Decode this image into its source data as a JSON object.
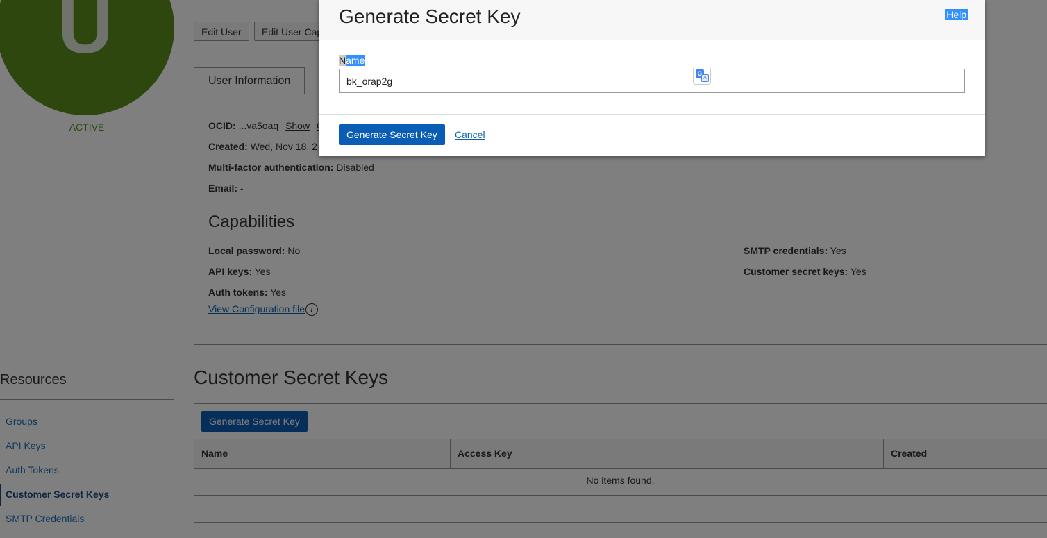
{
  "user": {
    "avatar_letter": "U",
    "status": "ACTIVE"
  },
  "actions": {
    "edit_user": "Edit User",
    "edit_capabilities": "Edit User Cap"
  },
  "tabs": {
    "user_information": "User Information"
  },
  "info": {
    "ocid_label": "OCID:",
    "ocid_value": "...va5oaq",
    "ocid_show": "Show",
    "ocid_copy": "C",
    "created_label": "Created:",
    "created_value": "Wed, Nov 18, 2",
    "mfa_label": "Multi-factor authentication:",
    "mfa_value": "Disabled",
    "email_label": "Email:",
    "email_value": "-"
  },
  "capabilities": {
    "title": "Capabilities",
    "local_password_label": "Local password:",
    "local_password_value": "No",
    "api_keys_label": "API keys:",
    "api_keys_value": "Yes",
    "auth_tokens_label": "Auth tokens:",
    "auth_tokens_value": "Yes",
    "smtp_label": "SMTP credentials:",
    "smtp_value": "Yes",
    "customer_secret_label": "Customer secret keys:",
    "customer_secret_value": "Yes",
    "view_config": "View Configuration file"
  },
  "resources": {
    "title": "Resources",
    "items": [
      {
        "label": "Groups"
      },
      {
        "label": "API Keys"
      },
      {
        "label": "Auth Tokens"
      },
      {
        "label": "Customer Secret Keys"
      },
      {
        "label": "SMTP Credentials"
      }
    ]
  },
  "secret_keys": {
    "title": "Customer Secret Keys",
    "generate_button": "Generate Secret Key",
    "columns": [
      "Name",
      "Access Key",
      "Created"
    ],
    "empty_text": "No items found."
  },
  "modal": {
    "title": "Generate Secret Key",
    "help": "Help",
    "name_label_first": "N",
    "name_label_rest": "ame",
    "name_value": "bk_orap2g",
    "submit": "Generate Secret Key",
    "cancel": "Cancel"
  }
}
